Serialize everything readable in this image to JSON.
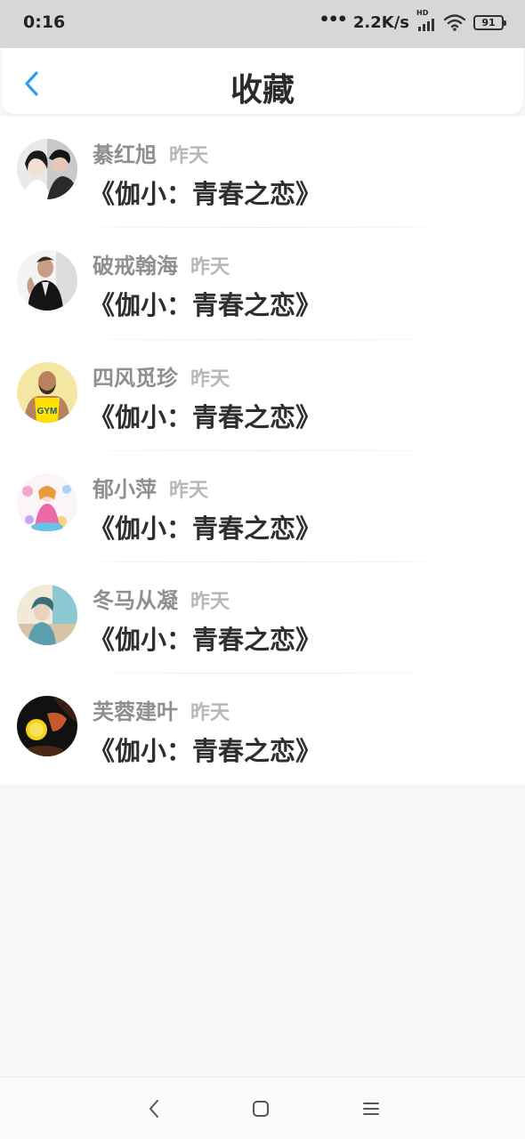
{
  "status_bar": {
    "time": "0:16",
    "net_dots": "•••",
    "net_speed": "2.2K/s",
    "hd": "HD",
    "battery": "91"
  },
  "header": {
    "title": "收藏",
    "back_icon": "chevron-left-icon",
    "accent_color": "#2a9df4"
  },
  "favorites": [
    {
      "name": "綦红旭",
      "time": "昨天",
      "book": "《伽小：青春之恋》"
    },
    {
      "name": "破戒翰海",
      "time": "昨天",
      "book": "《伽小：青春之恋》"
    },
    {
      "name": "四风觅珍",
      "time": "昨天",
      "book": "《伽小：青春之恋》"
    },
    {
      "name": "郁小萍",
      "time": "昨天",
      "book": "《伽小：青春之恋》"
    },
    {
      "name": "冬马从凝",
      "time": "昨天",
      "book": "《伽小：青春之恋》"
    },
    {
      "name": "芙蓉建叶",
      "time": "昨天",
      "book": "《伽小：青春之恋》"
    }
  ],
  "nav_bar": {
    "back": "nav-back-icon",
    "home": "nav-home-icon",
    "menu": "nav-menu-icon"
  }
}
